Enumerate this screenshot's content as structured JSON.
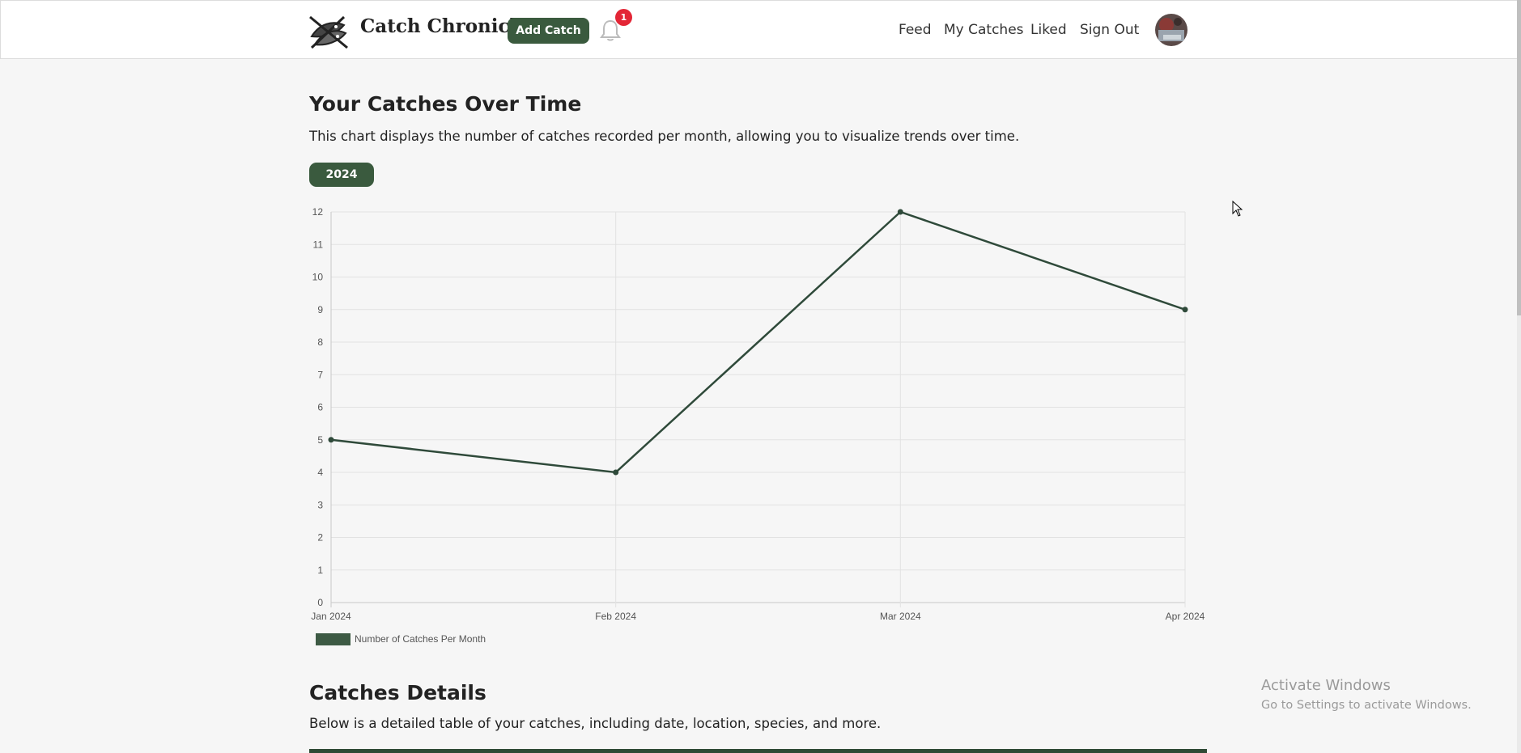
{
  "header": {
    "brand": "Catch Chronicle",
    "add_catch_label": "Add Catch",
    "notification_count": "1",
    "nav": [
      "Feed",
      "My Catches",
      "Liked",
      "Sign Out"
    ]
  },
  "main": {
    "chart_title": "Your Catches Over Time",
    "chart_description": "This chart displays the number of catches recorded per month, allowing you to visualize trends over time.",
    "year_button": "2024",
    "details_title": "Catches Details",
    "details_description": "Below is a detailed table of your catches, including date, location, species, and more."
  },
  "chart_data": {
    "type": "line",
    "categories": [
      "Jan 2024",
      "Feb 2024",
      "Mar 2024",
      "Apr 2024"
    ],
    "series": [
      {
        "name": "Number of Catches Per Month",
        "values": [
          5,
          4,
          12,
          9
        ]
      }
    ],
    "ylim": [
      0,
      12
    ],
    "yticks": [
      0,
      1,
      2,
      3,
      4,
      5,
      6,
      7,
      8,
      9,
      10,
      11,
      12
    ],
    "grid": true,
    "legend_position": "bottom-left",
    "line_color": "#2f4a3a"
  },
  "watermark": {
    "line1": "Activate Windows",
    "line2": "Go to Settings to activate Windows."
  },
  "colors": {
    "primary": "#3a5a3e",
    "badge": "#e32636",
    "background": "#f6f6f6"
  }
}
